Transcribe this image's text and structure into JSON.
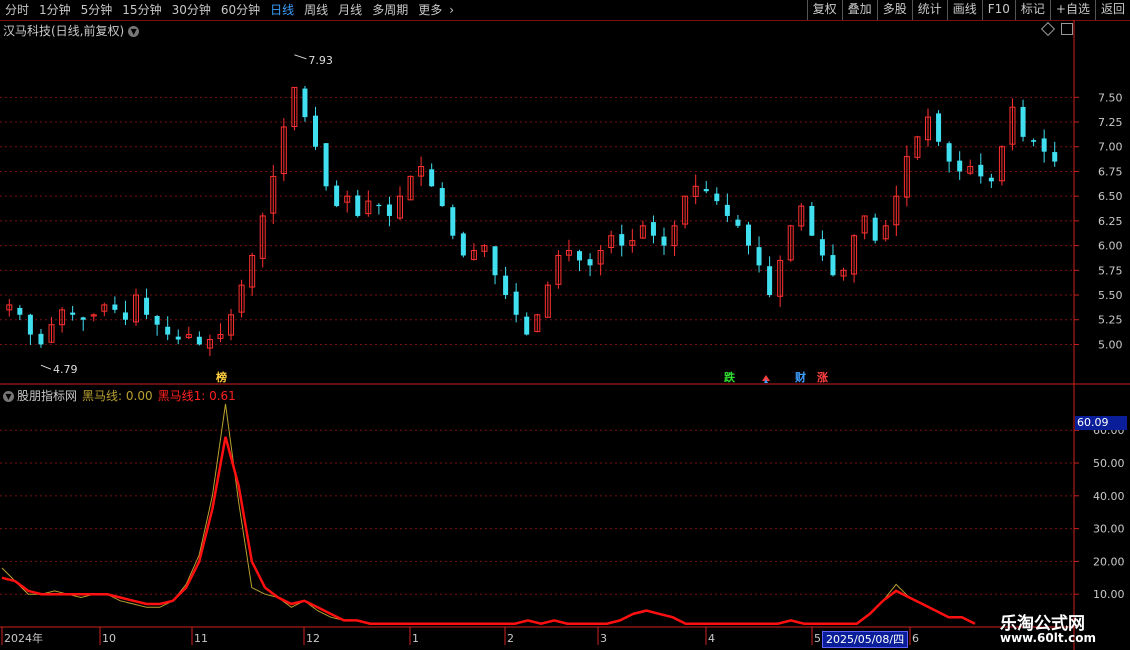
{
  "toolbar": {
    "periods": [
      "分时",
      "1分钟",
      "5分钟",
      "15分钟",
      "30分钟",
      "60分钟",
      "日线",
      "周线",
      "月线",
      "多周期",
      "更多"
    ],
    "active_period": "日线",
    "actions": [
      "复权",
      "叠加",
      "多股",
      "统计",
      "画线",
      "F10",
      "标记",
      "+自选",
      "返回"
    ]
  },
  "main": {
    "title": "汉马科技(日线,前复权)",
    "max_label": "7.93",
    "min_label": "4.79",
    "markers": [
      {
        "text": "榜",
        "color": "#ffd040"
      },
      {
        "text": "跌",
        "color": "#30e030"
      },
      {
        "text": "财",
        "color": "#40a0ff"
      },
      {
        "text": "涨",
        "color": "#ff4040"
      }
    ]
  },
  "indicator": {
    "name": "股朋指标网",
    "series1_label": "黑马线: 0.00",
    "series2_label": "黑马线1: 0.61",
    "current_value": "60.09",
    "cursor_date": "2025/05/08/四"
  },
  "watermark": {
    "line1": "乐淘公式网",
    "line2": "www.60lt.com"
  },
  "colors": {
    "up": "#ff3030",
    "down": "#40e0f0",
    "grid": "#7a1010",
    "axis": "#cc2020",
    "series1": "#b8a030",
    "series2": "#ff1010"
  },
  "chart_data": [
    {
      "type": "candlestick",
      "title": "汉马科技(日线,前复权)",
      "ylim": [
        4.6,
        8.1
      ],
      "y_ticks": [
        "5.00",
        "5.25",
        "5.50",
        "5.75",
        "6.00",
        "6.25",
        "6.50",
        "6.75",
        "7.00",
        "7.25",
        "7.50"
      ],
      "max_label": "7.93",
      "min_label": "4.79",
      "close_path_estimate": [
        5.4,
        5.3,
        5.1,
        5.0,
        5.2,
        5.35,
        5.3,
        5.25,
        5.3,
        5.4,
        5.35,
        5.25,
        5.5,
        5.3,
        5.2,
        5.1,
        5.05,
        5.1,
        5.0,
        5.05,
        5.1,
        5.3,
        5.6,
        5.9,
        6.3,
        6.7,
        7.2,
        7.6,
        7.3,
        7.0,
        6.6,
        6.4,
        6.5,
        6.3,
        6.45,
        6.4,
        6.3,
        6.5,
        6.7,
        6.8,
        6.6,
        6.4,
        6.1,
        5.9,
        5.95,
        6.0,
        5.7,
        5.5,
        5.3,
        5.1,
        5.3,
        5.6,
        5.9,
        5.95,
        5.85,
        5.8,
        5.95,
        6.1,
        6.0,
        6.05,
        6.2,
        6.1,
        6.0,
        6.2,
        6.5,
        6.6,
        6.55,
        6.45,
        6.3,
        6.2,
        6.0,
        5.8,
        5.5,
        5.85,
        6.2,
        6.4,
        6.1,
        5.9,
        5.7,
        5.75,
        6.1,
        6.3,
        6.05,
        6.2,
        6.5,
        6.9,
        7.1,
        7.3,
        7.05,
        6.85,
        6.75,
        6.8,
        6.7,
        6.65,
        7.0,
        7.4,
        7.1,
        7.05,
        6.95,
        6.85
      ]
    },
    {
      "type": "line",
      "series": [
        {
          "name": "黑马线",
          "values": [
            18,
            14,
            10,
            10,
            11,
            10,
            9,
            10,
            10,
            8,
            7,
            6,
            6,
            8,
            13,
            22,
            40,
            68,
            38,
            12,
            10,
            9,
            6,
            8,
            5,
            3,
            2,
            2,
            1,
            1,
            1,
            1,
            1,
            1,
            1,
            1,
            1,
            1,
            1,
            1,
            2,
            1,
            2,
            1,
            1,
            1,
            1,
            2,
            4,
            5,
            4,
            3,
            1,
            1,
            1,
            1,
            1,
            1,
            1,
            1,
            2,
            1,
            1,
            1,
            1,
            1,
            4,
            8,
            13,
            9,
            7,
            5,
            3,
            3,
            1
          ]
        },
        {
          "name": "黑马线1",
          "values": [
            15,
            14,
            11,
            10,
            10,
            10,
            10,
            10,
            10,
            9,
            8,
            7,
            7,
            8,
            12,
            20,
            36,
            58,
            43,
            20,
            12,
            9,
            7,
            8,
            6,
            4,
            2,
            2,
            1,
            1,
            1,
            1,
            1,
            1,
            1,
            1,
            1,
            1,
            1,
            1,
            2,
            1,
            2,
            1,
            1,
            1,
            1,
            2,
            4,
            5,
            4,
            3,
            1,
            1,
            1,
            1,
            1,
            1,
            1,
            1,
            2,
            1,
            1,
            1,
            1,
            1,
            4,
            8,
            11,
            9,
            7,
            5,
            3,
            3,
            1
          ]
        }
      ],
      "ylim": [
        0,
        68
      ],
      "y_ticks": [
        "10.00",
        "20.00",
        "30.00",
        "40.00",
        "50.00",
        "60.00"
      ],
      "current_value": "60.09"
    }
  ],
  "x_axis": {
    "labels": [
      "2024年",
      "10",
      "11",
      "12",
      "1",
      "2",
      "3",
      "4",
      "5",
      "6"
    ],
    "cursor_date": "2025/05/08/四"
  }
}
